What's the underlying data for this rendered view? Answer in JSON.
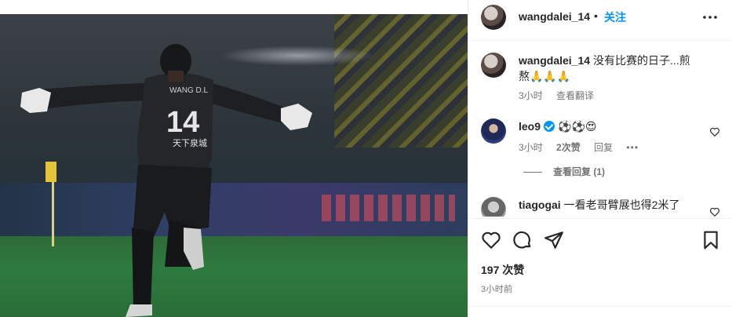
{
  "post": {
    "author": "wangdalei_14",
    "separator": "•",
    "follow_label": "关注",
    "likes_text": "197 次赞",
    "time_ago": "3小时前"
  },
  "photo": {
    "jersey_name": "WANG D.L",
    "jersey_number": "14",
    "jersey_sponsor": "天下泉城"
  },
  "caption": {
    "username": "wangdalei_14",
    "text": "没有比赛的日子...煎熬🙏🙏🙏",
    "time": "3小时",
    "translate_label": "查看翻译"
  },
  "comments": [
    {
      "username": "leo9",
      "text": "⚽⚽😍",
      "time": "3小时",
      "likes": "2次赞",
      "reply_label": "回复",
      "view_replies": "查看回复 (1)"
    },
    {
      "username": "tiagogai",
      "text": "一看老哥臂展也得2米了"
    }
  ],
  "colors": {
    "accent": "#0095f6",
    "text": "#262626",
    "muted": "#737373",
    "divider": "#efefef"
  }
}
